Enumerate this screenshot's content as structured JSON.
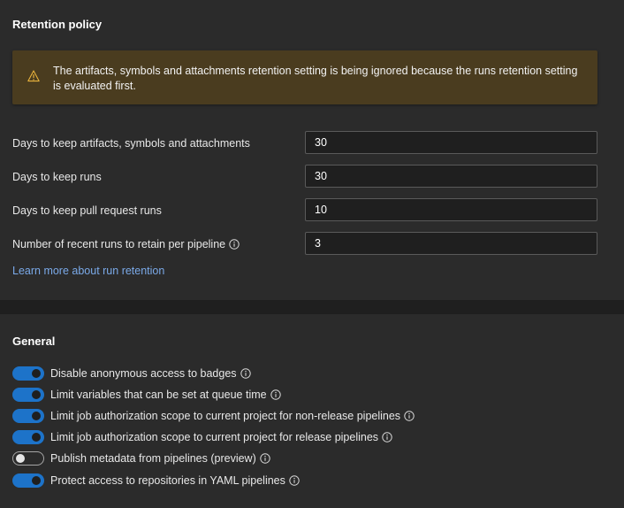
{
  "retention": {
    "title": "Retention policy",
    "warning": {
      "icon": "warning-icon",
      "text": "The artifacts, symbols and attachments retention setting is being ignored because the runs retention setting is evaluated first."
    },
    "fields": [
      {
        "label": "Days to keep artifacts, symbols and attachments",
        "value": "30",
        "info": false
      },
      {
        "label": "Days to keep runs",
        "value": "30",
        "info": false
      },
      {
        "label": "Days to keep pull request runs",
        "value": "10",
        "info": false
      },
      {
        "label": "Number of recent runs to retain per pipeline",
        "value": "3",
        "info": true
      }
    ],
    "learn_more": "Learn more about run retention"
  },
  "general": {
    "title": "General",
    "toggles": [
      {
        "label": "Disable anonymous access to badges",
        "on": true
      },
      {
        "label": "Limit variables that can be set at queue time",
        "on": true
      },
      {
        "label": "Limit job authorization scope to current project for non-release pipelines",
        "on": true
      },
      {
        "label": "Limit job authorization scope to current project for release pipelines",
        "on": true
      },
      {
        "label": "Publish metadata from pipelines (preview)",
        "on": false
      },
      {
        "label": "Protect access to repositories in YAML pipelines",
        "on": true
      }
    ]
  },
  "colors": {
    "toggle_on": "#1d73c9",
    "link": "#7aa9e8",
    "warning_bg": "#4a3c1f",
    "warning_icon": "#e8b23c"
  }
}
